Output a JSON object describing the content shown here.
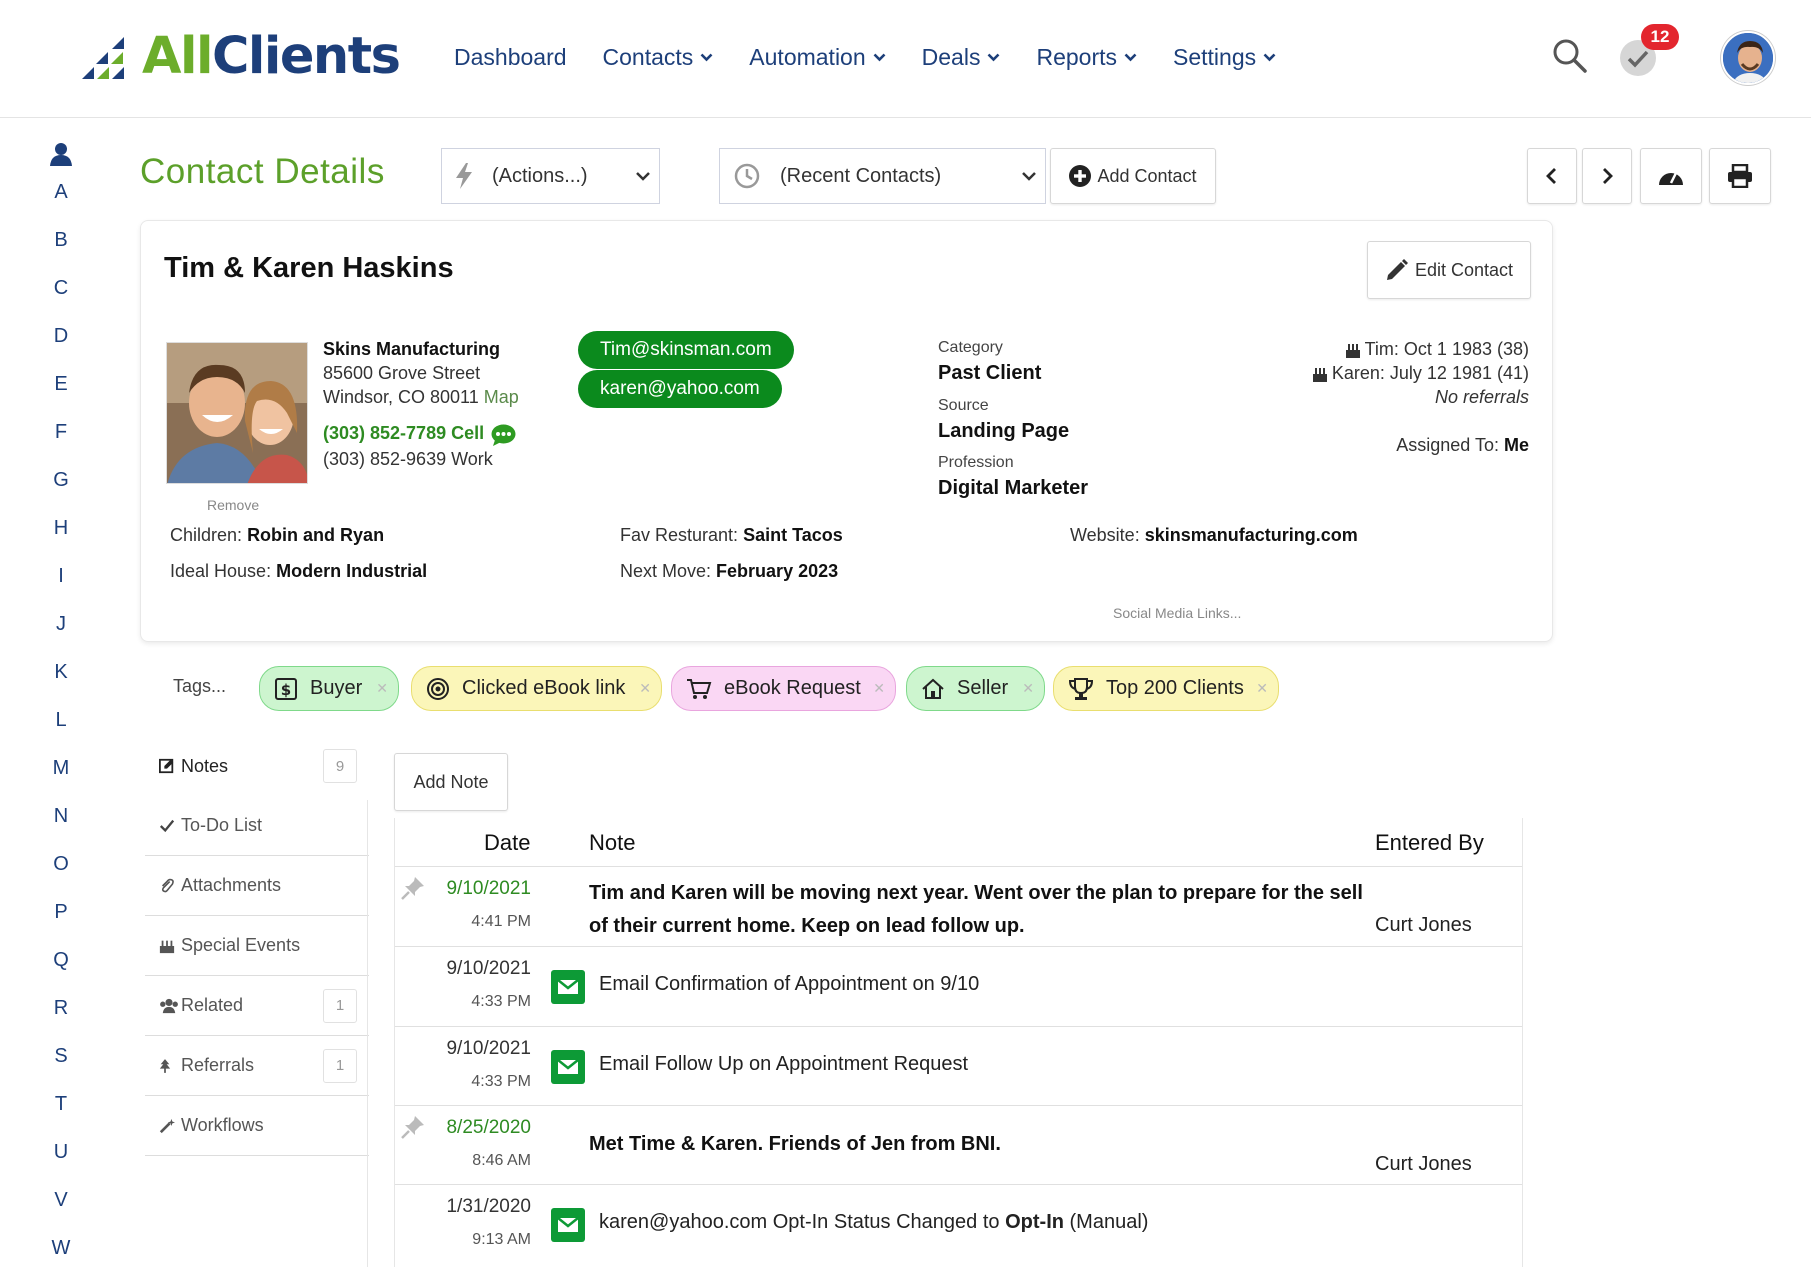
{
  "brand": {
    "logo_part1": "All",
    "logo_part2": "Clients"
  },
  "nav": [
    "Dashboard",
    "Contacts",
    "Automation",
    "Deals",
    "Reports",
    "Settings"
  ],
  "nav_has_dropdown": [
    false,
    true,
    true,
    true,
    true,
    true
  ],
  "notifications": {
    "count": "12"
  },
  "alphabet": [
    "A",
    "B",
    "C",
    "D",
    "E",
    "F",
    "G",
    "H",
    "I",
    "J",
    "K",
    "L",
    "M",
    "N",
    "O",
    "P",
    "Q",
    "R",
    "S",
    "T",
    "U",
    "V",
    "W"
  ],
  "page": {
    "title": "Contact Details",
    "actions_select": "(Actions...)",
    "recent_select": "(Recent Contacts)",
    "add_contact": "Add Contact",
    "edit_contact": "Edit Contact"
  },
  "contact": {
    "name": "Tim & Karen Haskins",
    "remove": "Remove",
    "company": "Skins Manufacturing",
    "street": "85600 Grove Street",
    "city": "Windsor, CO 80011",
    "map": "Map",
    "phone_cell": "(303) 852-7789 Cell",
    "phone_work": "(303) 852-9639 Work",
    "emails": [
      "Tim@skinsman.com",
      "karen@yahoo.com"
    ],
    "category_label": "Category",
    "category": "Past Client",
    "source_label": "Source",
    "source": "Landing Page",
    "profession_label": "Profession",
    "profession": "Digital Marketer",
    "birthdays": [
      "Tim: Oct 1 1983 (38)",
      "Karen: July 12 1981 (41)"
    ],
    "referrals": "No referrals",
    "assigned_label": "Assigned To:",
    "assigned": "Me",
    "children_label": "Children:",
    "children": "Robin and Ryan",
    "house_label": "Ideal House:",
    "house": "Modern Industrial",
    "restaurant_label": "Fav Resturant:",
    "restaurant": "Saint Tacos",
    "move_label": "Next Move:",
    "move": "February 2023",
    "website_label": "Website:",
    "website": "skinsmanufacturing.com",
    "social": "Social Media Links..."
  },
  "tags_label": "Tags...",
  "tags": [
    {
      "label": "Buyer",
      "icon": "dollar-icon",
      "bg": "#cdf5cf",
      "border": "#7fd98a"
    },
    {
      "label": "Clicked eBook link",
      "icon": "target-icon",
      "bg": "#fbf6b9",
      "border": "#e9de6f"
    },
    {
      "label": "eBook Request",
      "icon": "cart-icon",
      "bg": "#fad7f4",
      "border": "#e9a5de"
    },
    {
      "label": "Seller",
      "icon": "home-icon",
      "bg": "#cdf5cf",
      "border": "#7fd98a"
    },
    {
      "label": "Top 200 Clients",
      "icon": "trophy-icon",
      "bg": "#fbf6b9",
      "border": "#e9de6f"
    }
  ],
  "sidebar": [
    {
      "label": "Notes",
      "icon": "edit-square-icon",
      "count": "9"
    },
    {
      "label": "To-Do List",
      "icon": "checkmark-icon",
      "count": ""
    },
    {
      "label": "Attachments",
      "icon": "paperclip-icon",
      "count": ""
    },
    {
      "label": "Special Events",
      "icon": "cake-icon",
      "count": ""
    },
    {
      "label": "Related",
      "icon": "users-icon",
      "count": "1"
    },
    {
      "label": "Referrals",
      "icon": "tree-icon",
      "count": "1"
    },
    {
      "label": "Workflows",
      "icon": "magic-wand-icon",
      "count": ""
    }
  ],
  "notes": {
    "add_note": "Add Note",
    "headers": [
      "Date",
      "Note",
      "Entered By"
    ],
    "rows": [
      {
        "date": "9/10/2021",
        "time": "4:41 PM",
        "note": "Tim and Karen will be moving next year. Went over the plan to prepare for the sell of their current home. Keep on lead follow up.",
        "by": "Curt Jones",
        "pinned": true,
        "email": false,
        "bold": true,
        "date_color": "#2e8b22"
      },
      {
        "date": "9/10/2021",
        "time": "4:33 PM",
        "note": "Email Confirmation of Appointment on 9/10",
        "by": "",
        "pinned": false,
        "email": true,
        "bold": false,
        "date_color": "#333333"
      },
      {
        "date": "9/10/2021",
        "time": "4:33 PM",
        "note": "Email Follow Up on Appointment Request",
        "by": "",
        "pinned": false,
        "email": true,
        "bold": false,
        "date_color": "#333333"
      },
      {
        "date": "8/25/2020",
        "time": "8:46 AM",
        "note": "Met Time & Karen. Friends of Jen from BNI.",
        "by": "Curt Jones",
        "pinned": true,
        "email": false,
        "bold": true,
        "date_color": "#2e8b22"
      },
      {
        "date": "1/31/2020",
        "time": "9:13 AM",
        "note_pre": "karen@yahoo.com Opt-In Status Changed to ",
        "note_bold": "Opt-In",
        "note_post": " (Manual)",
        "by": "",
        "pinned": false,
        "email": true,
        "bold": false,
        "date_color": "#333333"
      }
    ]
  },
  "colors": {
    "brand_green": "#5ca02a",
    "brand_blue": "#1d3f7a",
    "email_green": "#0b8a1d",
    "badge_red": "#e3262e"
  }
}
